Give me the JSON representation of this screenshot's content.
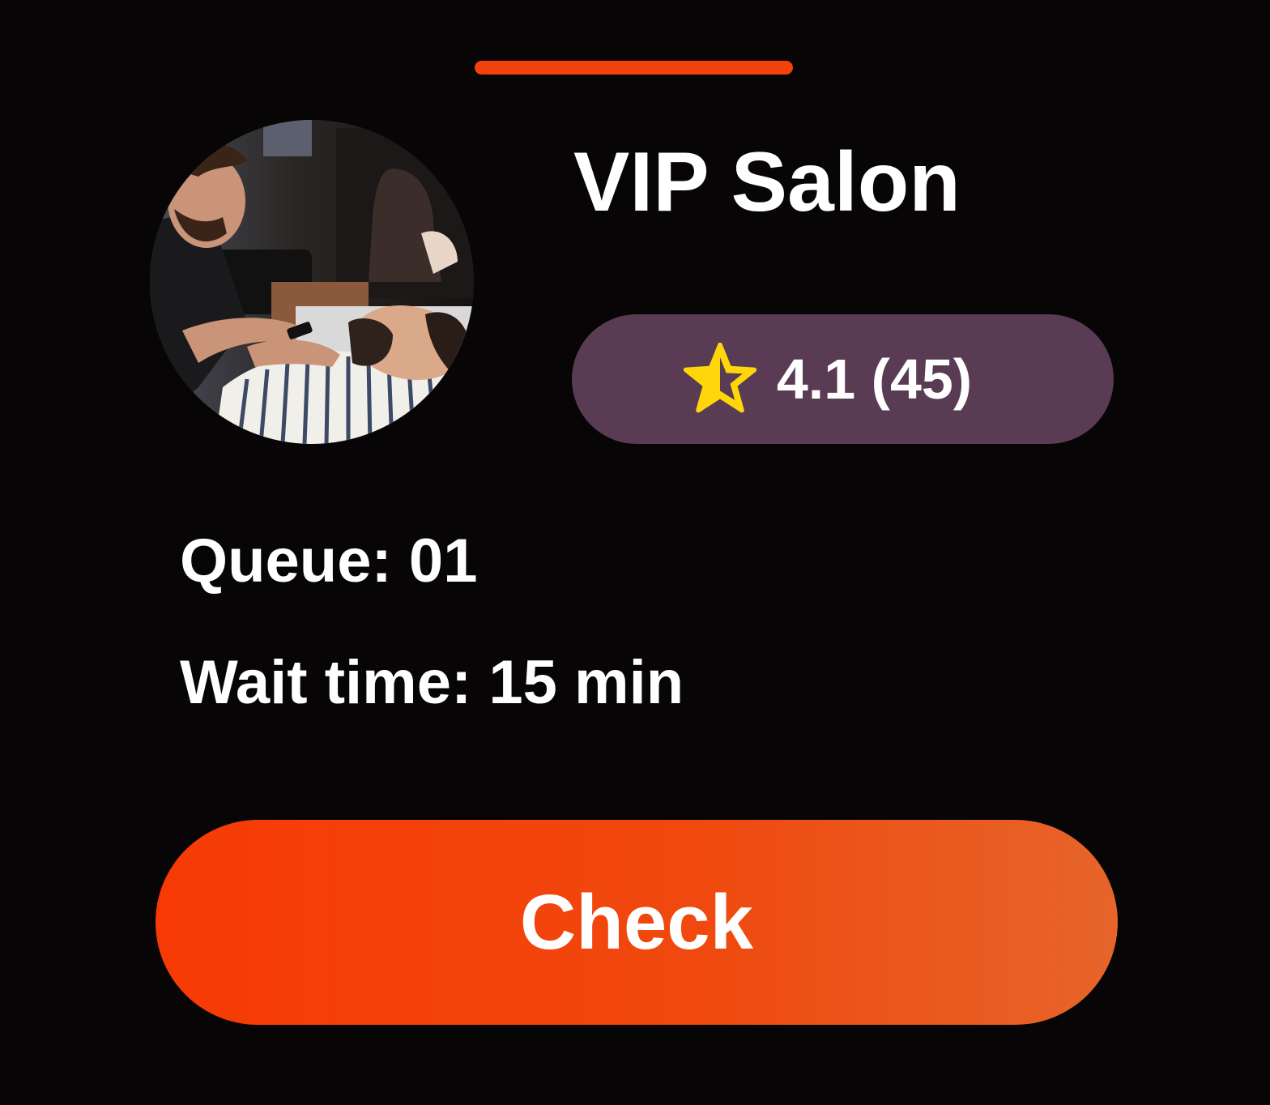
{
  "salon": {
    "name": "VIP Salon",
    "photo_icon": "barber-photo",
    "rating": {
      "icon": "star-half-icon",
      "text": "4.1 (45)",
      "value": 4.1,
      "count": 45
    },
    "queue_text": "Queue: 01",
    "wait_text": "Wait time: 15 min"
  },
  "actions": {
    "check_label": "Check"
  },
  "colors": {
    "accent": "#f2410b",
    "background": "#070505",
    "rating_pill": "#5a3b54",
    "star": "#ffd60a"
  }
}
